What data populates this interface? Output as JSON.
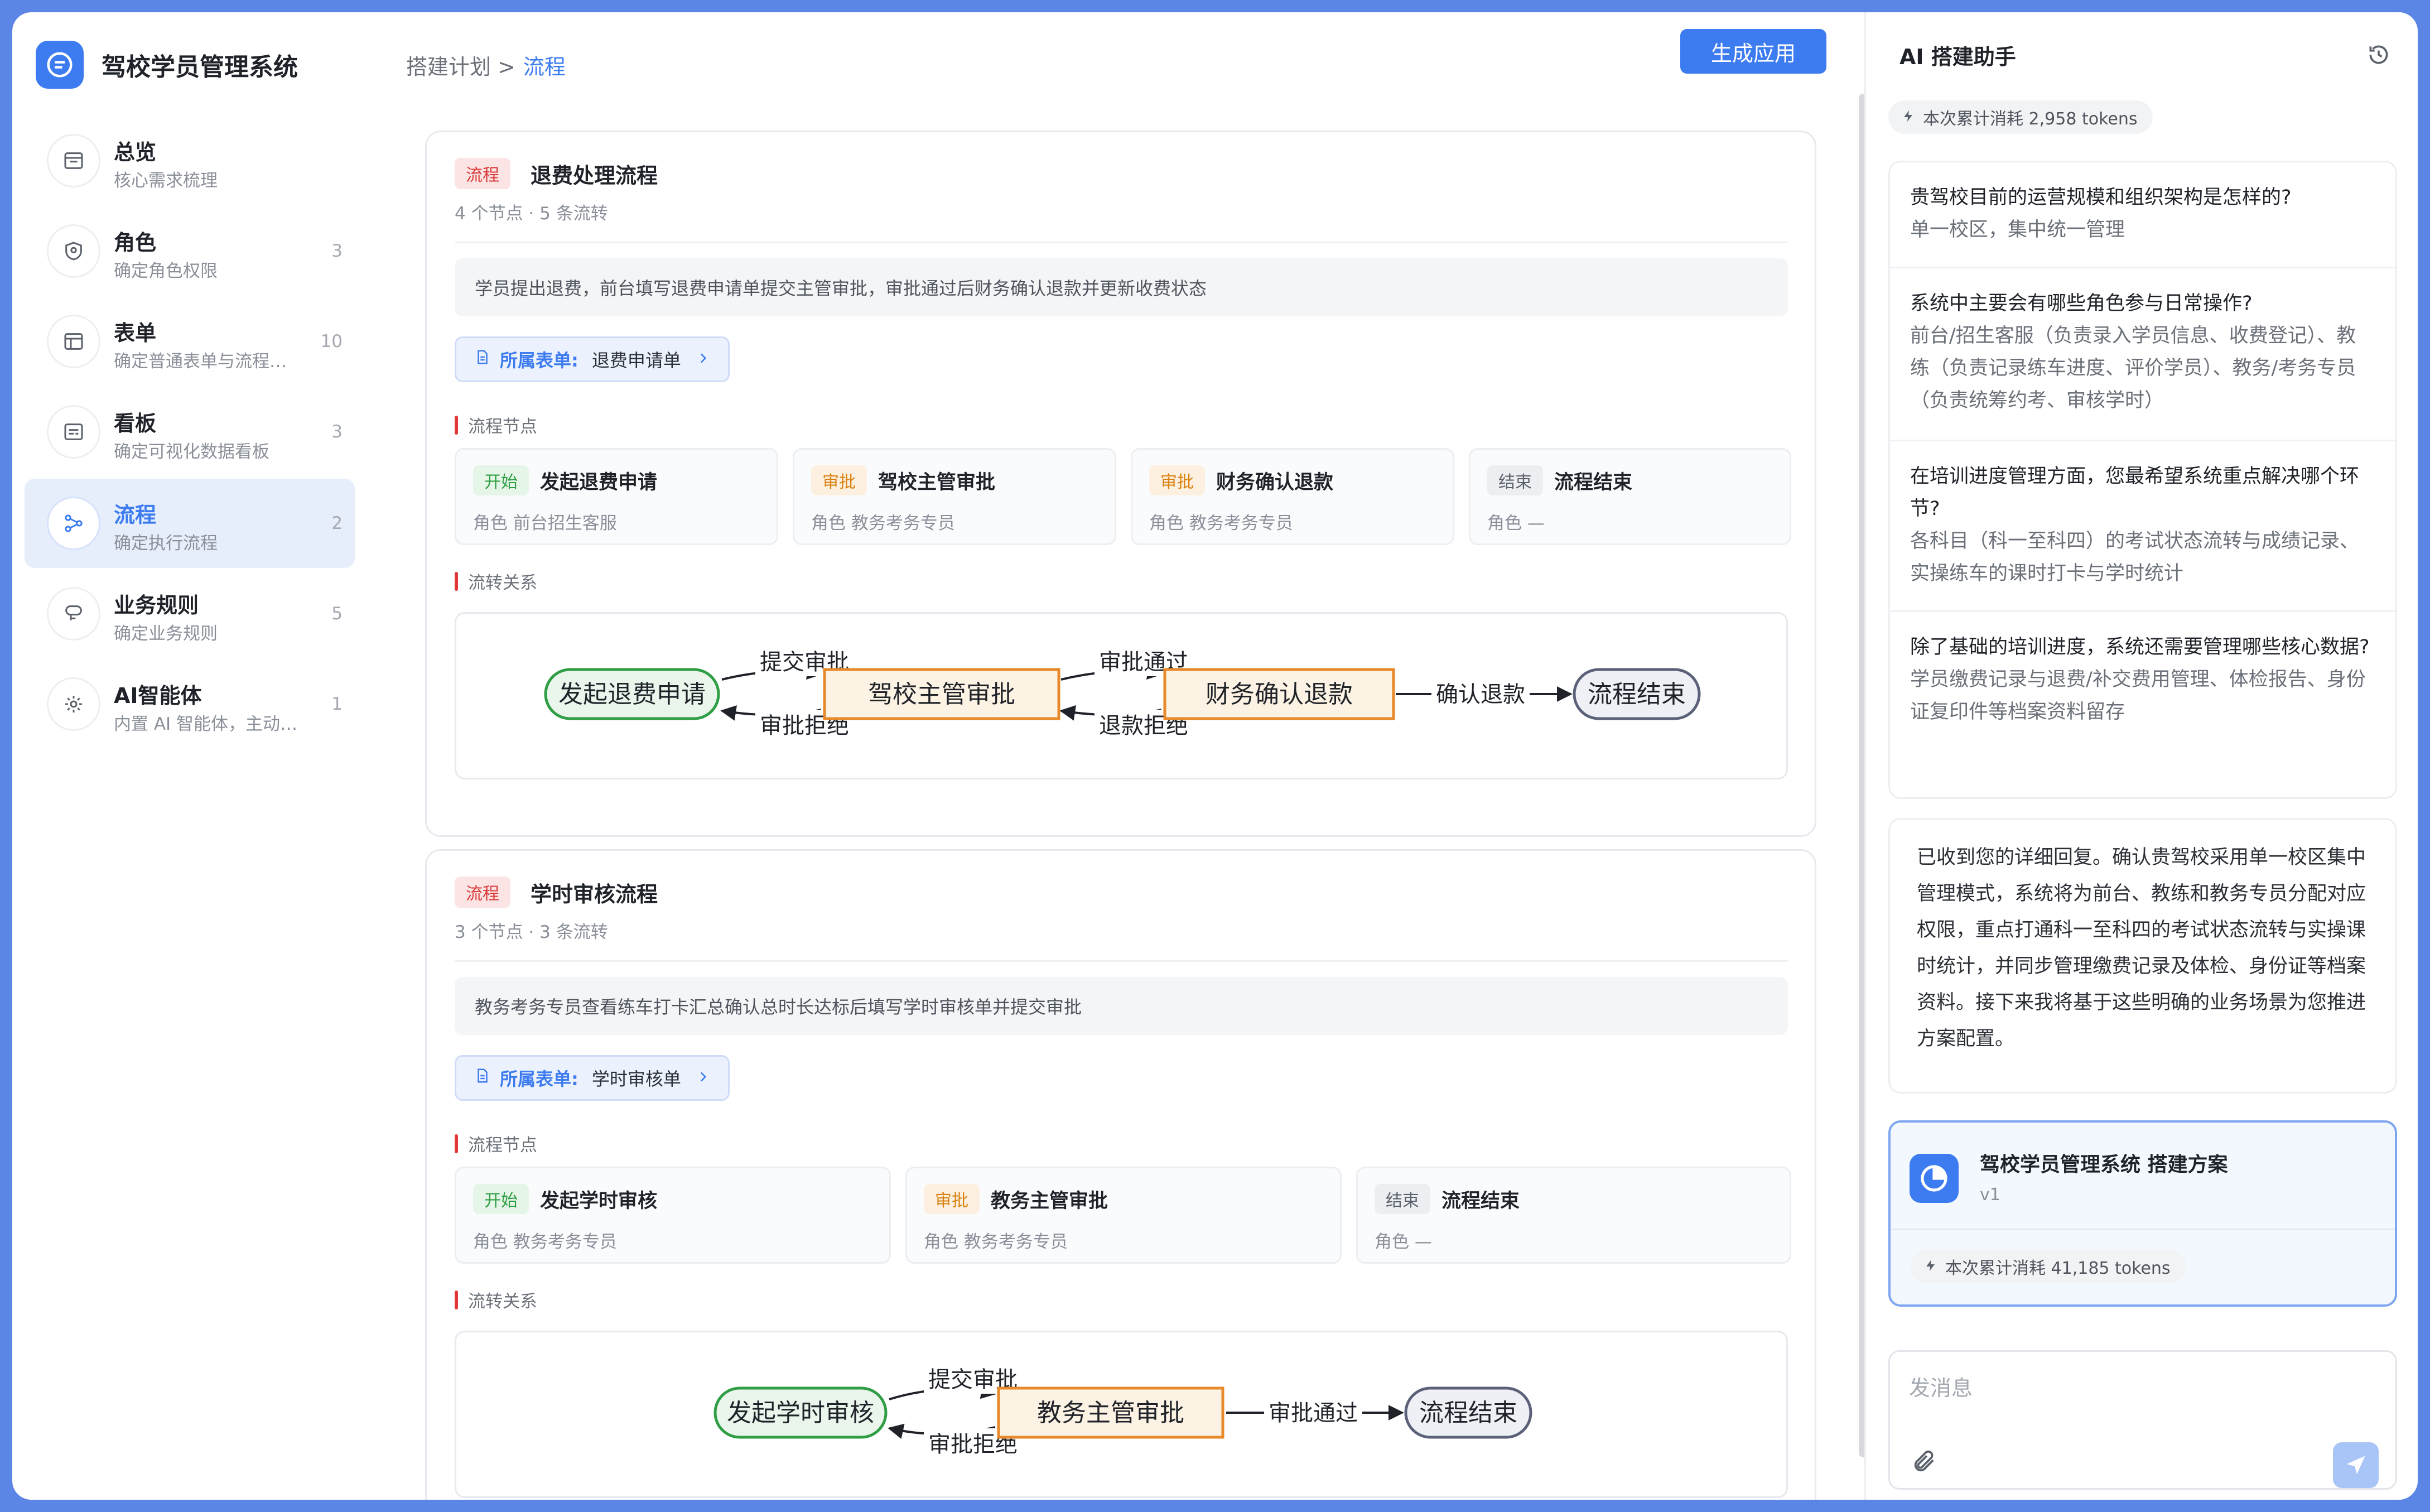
{
  "app": {
    "title": "驾校学员管理系统"
  },
  "sidebar": {
    "items": [
      {
        "label": "总览",
        "sub": "核心需求梳理",
        "count": ""
      },
      {
        "label": "角色",
        "sub": "确定角色权限",
        "count": "3"
      },
      {
        "label": "表单",
        "sub": "确定普通表单与流程表单",
        "count": "10"
      },
      {
        "label": "看板",
        "sub": "确定可视化数据看板",
        "count": "3"
      },
      {
        "label": "流程",
        "sub": "确定执行流程",
        "count": "2"
      },
      {
        "label": "业务规则",
        "sub": "确定业务规则",
        "count": "5"
      },
      {
        "label": "AI智能体",
        "sub": "内置 AI 智能体，主动服务",
        "count": "1"
      }
    ],
    "active_index": 4
  },
  "header": {
    "breadcrumb_parent": "搭建计划 >",
    "breadcrumb_current": "流程",
    "generate_label": "生成应用"
  },
  "flows": [
    {
      "tag": "流程",
      "title": "退费处理流程",
      "meta": "4 个节点 · 5 条流转",
      "description": "学员提出退费，前台填写退费申请单提交主管审批，审批通过后财务确认退款并更新收费状态",
      "form_label": "所属表单:",
      "form_value": "退费申请单",
      "nodes_label": "流程节点",
      "edges_label": "流转关系",
      "nodes": [
        {
          "badge": "开始",
          "type": "start",
          "name": "发起退费申请",
          "role": "角色  前台招生客服"
        },
        {
          "badge": "审批",
          "type": "approve",
          "name": "驾校主管审批",
          "role": "角色  教务考务专员"
        },
        {
          "badge": "审批",
          "type": "approve",
          "name": "财务确认退款",
          "role": "角色  教务考务专员"
        },
        {
          "badge": "结束",
          "type": "end",
          "name": "流程结束",
          "role": "角色  —"
        }
      ],
      "diagram": {
        "nodes": [
          "发起退费申请",
          "驾校主管审批",
          "财务确认退款",
          "流程结束"
        ],
        "edges": [
          "提交审批",
          "审批拒绝",
          "审批通过",
          "退款拒绝",
          "确认退款"
        ]
      }
    },
    {
      "tag": "流程",
      "title": "学时审核流程",
      "meta": "3 个节点 · 3 条流转",
      "description": "教务考务专员查看练车打卡汇总确认总时长达标后填写学时审核单并提交审批",
      "form_label": "所属表单:",
      "form_value": "学时审核单",
      "nodes_label": "流程节点",
      "edges_label": "流转关系",
      "nodes": [
        {
          "badge": "开始",
          "type": "start",
          "name": "发起学时审核",
          "role": "角色  教务考务专员"
        },
        {
          "badge": "审批",
          "type": "approve",
          "name": "教务主管审批",
          "role": "角色  教务考务专员"
        },
        {
          "badge": "结束",
          "type": "end",
          "name": "流程结束",
          "role": "角色  —"
        }
      ],
      "diagram": {
        "nodes": [
          "发起学时审核",
          "教务主管审批",
          "流程结束"
        ],
        "edges": [
          "提交审批",
          "审批拒绝",
          "审批通过"
        ]
      }
    }
  ],
  "assistant": {
    "title": "AI 搭建助手",
    "token_summary": "本次累计消耗 2,958 tokens",
    "qa": [
      {
        "q": "贵驾校目前的运营规模和组织架构是怎样的?",
        "a": "单一校区，集中统一管理"
      },
      {
        "q": "系统中主要会有哪些角色参与日常操作?",
        "a": "前台/招生客服（负责录入学员信息、收费登记）、教练（负责记录练车进度、评价学员）、教务/考务专员（负责统筹约考、审核学时）"
      },
      {
        "q": "在培训进度管理方面，您最希望系统重点解决哪个环节?",
        "a": "各科目（科一至科四）的考试状态流转与成绩记录、实操练车的课时打卡与学时统计"
      },
      {
        "q": "除了基础的培训进度，系统还需要管理哪些核心数据?",
        "a": "学员缴费记录与退费/补交费用管理、体检报告、身份证复印件等档案资料留存"
      }
    ],
    "reply": "已收到您的详细回复。确认贵驾校采用单一校区集中管理模式，系统将为前台、教练和教务专员分配对应权限，重点打通科一至科四的考试状态流转与实操课时统计，并同步管理缴费记录及体检、身份证等档案资料。接下来我将基于这些明确的业务场景为您推进方案配置。",
    "plan": {
      "title": "驾校学员管理系统  搭建方案",
      "version": "v1",
      "tokens": "本次累计消耗 41,185 tokens"
    },
    "message_placeholder": "发消息"
  },
  "colors": {
    "accent": "#3d7bf0",
    "frame": "#5b86e5",
    "start_node": "#2f9e44",
    "approve_node": "#e8892a",
    "end_node": "#5b6178"
  }
}
